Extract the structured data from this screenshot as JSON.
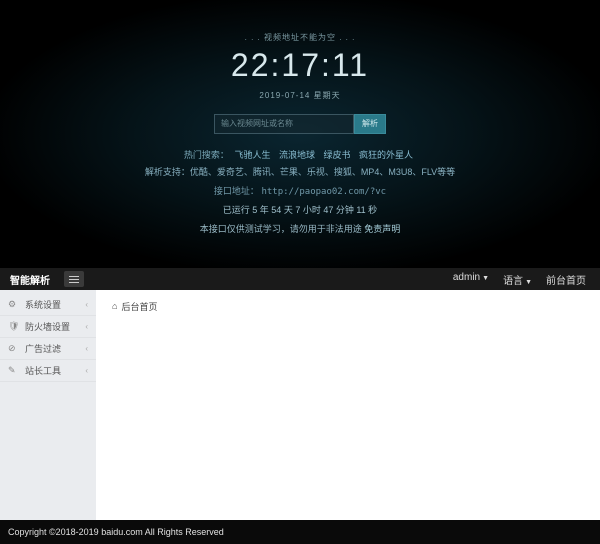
{
  "video": {
    "tagline": ". . . 视频地址不能为空 . . .",
    "clock": "22:17:11",
    "date": "2019-07-14 星期天",
    "search_placeholder": "输入视频网址或名称",
    "search_button": "解析",
    "hot_label": "热门搜索：",
    "hot_items": [
      "飞驰人生",
      "流浪地球",
      "绿皮书",
      "疯狂的外星人"
    ],
    "support_text": "解析支持：优酷、爱奇艺、腾讯、芒果、乐视、搜狐、MP4、M3U8、FLV等等",
    "api_label": "接口地址：",
    "api_url": "http://paopao02.com/?vc",
    "runtime": "已运行 5 年 54 天 7 小时 47 分钟 11 秒",
    "notice_pre": "本接口仅供测试学习，请勿用于非法用途 ",
    "notice_link": "免责声明"
  },
  "admin": {
    "brand": "智能解析",
    "top_links": {
      "admin": "admin",
      "lang": "语言",
      "home": "前台首页"
    },
    "sidebar": [
      {
        "icon": "⚙",
        "label": "系统设置"
      },
      {
        "icon": "🛡",
        "label": "防火墙设置"
      },
      {
        "icon": "⊘",
        "label": "广告过滤"
      },
      {
        "icon": "✎",
        "label": "站长工具"
      }
    ],
    "tab_home": "后台首页"
  },
  "footer": "Copyright ©2018-2019 baidu.com All Rights Reserved"
}
